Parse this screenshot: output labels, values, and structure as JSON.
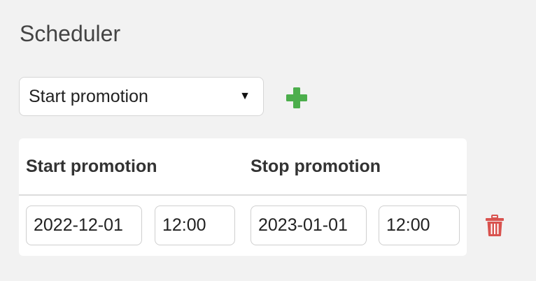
{
  "page": {
    "title": "Scheduler"
  },
  "action_select": {
    "selected": "Start promotion"
  },
  "add_button": {
    "icon": "plus-icon",
    "color": "#4cae4c"
  },
  "schedule_table": {
    "headers": [
      "Start promotion",
      "Stop promotion"
    ],
    "rows": [
      {
        "start_date": "2022-12-01",
        "start_time": "12:00",
        "stop_date": "2023-01-01",
        "stop_time": "12:00"
      }
    ]
  },
  "delete_button": {
    "icon": "trash-icon",
    "color": "#d9534f"
  }
}
